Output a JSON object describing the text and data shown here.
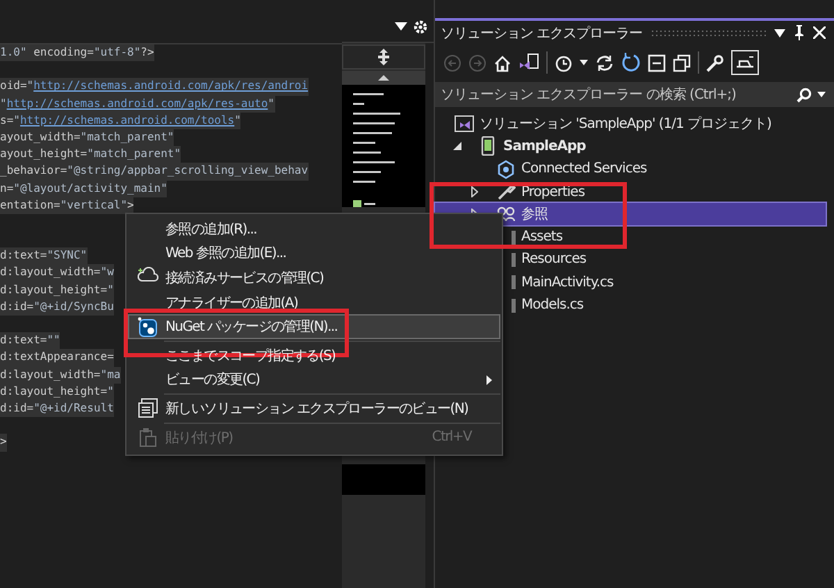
{
  "editor": {
    "lines": [
      {
        "kind": "code",
        "segments": [
          {
            "text": "1.0\"",
            "kind": "value"
          },
          {
            "text": " encoding=",
            "kind": "plain"
          },
          {
            "text": "\"utf-8\"",
            "kind": "value"
          },
          {
            "text": "?>",
            "kind": "plain"
          }
        ]
      },
      {
        "kind": "blank"
      },
      {
        "kind": "code",
        "segments": [
          {
            "text": "oid=",
            "kind": "plain"
          },
          {
            "text": "\"",
            "kind": "value"
          },
          {
            "text": "http://schemas.android.com/apk/res/androi",
            "kind": "link"
          }
        ]
      },
      {
        "kind": "code",
        "segments": [
          {
            "text": "\"",
            "kind": "value"
          },
          {
            "text": "http://schemas.android.com/apk/res-auto",
            "kind": "link"
          },
          {
            "text": "\"",
            "kind": "value"
          }
        ]
      },
      {
        "kind": "code",
        "segments": [
          {
            "text": "s=",
            "kind": "plain"
          },
          {
            "text": "\"",
            "kind": "value"
          },
          {
            "text": "http://schemas.android.com/tools",
            "kind": "link"
          },
          {
            "text": "\"",
            "kind": "value"
          }
        ]
      },
      {
        "kind": "code",
        "segments": [
          {
            "text": "ayout_width=",
            "kind": "plain"
          },
          {
            "text": "\"match_parent\"",
            "kind": "value"
          }
        ]
      },
      {
        "kind": "code",
        "segments": [
          {
            "text": "ayout_height=",
            "kind": "plain"
          },
          {
            "text": "\"match_parent\"",
            "kind": "value"
          }
        ]
      },
      {
        "kind": "code",
        "segments": [
          {
            "text": "_behavior=",
            "kind": "plain"
          },
          {
            "text": "\"@string/appbar_scrolling_view_behav",
            "kind": "value"
          }
        ]
      },
      {
        "kind": "code",
        "segments": [
          {
            "text": "n=",
            "kind": "plain"
          },
          {
            "text": "\"@layout/activity_main\"",
            "kind": "value"
          }
        ]
      },
      {
        "kind": "code",
        "segments": [
          {
            "text": "entation=",
            "kind": "plain"
          },
          {
            "text": "\"vertical\"",
            "kind": "value"
          },
          {
            "text": ">",
            "kind": "plain"
          }
        ]
      },
      {
        "kind": "blank"
      },
      {
        "kind": "blank"
      },
      {
        "kind": "code",
        "segments": [
          {
            "text": "d:text=",
            "kind": "plain"
          },
          {
            "text": "\"SYNC\"",
            "kind": "value"
          }
        ]
      },
      {
        "kind": "code",
        "segments": [
          {
            "text": "d:layout_width=",
            "kind": "plain"
          },
          {
            "text": "\"w",
            "kind": "value"
          }
        ]
      },
      {
        "kind": "code",
        "segments": [
          {
            "text": "d:layout_height=",
            "kind": "plain"
          },
          {
            "text": "\"",
            "kind": "value"
          }
        ]
      },
      {
        "kind": "code",
        "segments": [
          {
            "text": "d:id=",
            "kind": "plain"
          },
          {
            "text": "\"@+id/SyncBu",
            "kind": "value"
          }
        ]
      },
      {
        "kind": "blank"
      },
      {
        "kind": "code",
        "segments": [
          {
            "text": "d:text=",
            "kind": "plain"
          },
          {
            "text": "\"\"",
            "kind": "value"
          }
        ]
      },
      {
        "kind": "code",
        "segments": [
          {
            "text": "d:textAppearance=",
            "kind": "plain"
          }
        ]
      },
      {
        "kind": "code",
        "segments": [
          {
            "text": "d:layout_width=",
            "kind": "plain"
          },
          {
            "text": "\"ma",
            "kind": "value"
          }
        ]
      },
      {
        "kind": "code",
        "segments": [
          {
            "text": "d:layout_height=",
            "kind": "plain"
          },
          {
            "text": "\"",
            "kind": "value"
          }
        ]
      },
      {
        "kind": "code",
        "segments": [
          {
            "text": "d:id=",
            "kind": "plain"
          },
          {
            "text": "\"@+id/Result",
            "kind": "value"
          }
        ]
      },
      {
        "kind": "blank"
      },
      {
        "kind": "code",
        "segments": [
          {
            "text": ">",
            "kind": "plain"
          }
        ]
      }
    ]
  },
  "solution_explorer": {
    "title": "ソリューション エクスプローラー",
    "search": {
      "placeholder": "ソリューション エクスプローラー の検索 (Ctrl+;)"
    },
    "tree": [
      {
        "label": "ソリューション 'SampleApp' (1/1 プロジェクト)",
        "kind": "solution",
        "selected": false,
        "annotated": false,
        "children": [
          {
            "label": "SampleApp",
            "kind": "project",
            "expanded": true,
            "selected": false,
            "annotated": false,
            "children": [
              {
                "label": "Connected Services",
                "kind": "services",
                "selected": false,
                "annotated": false
              },
              {
                "label": "Properties",
                "kind": "properties",
                "expanded": false,
                "selected": false,
                "annotated": false
              },
              {
                "label": "参照",
                "kind": "references",
                "expanded": false,
                "selected": true,
                "annotated": true
              },
              {
                "label": "Assets",
                "kind": "folder",
                "selected": false,
                "annotated": false
              },
              {
                "label": "Resources",
                "kind": "folder",
                "selected": false,
                "annotated": false
              },
              {
                "label": "MainActivity.cs",
                "kind": "file",
                "selected": false,
                "annotated": false
              },
              {
                "label": "Models.cs",
                "kind": "file",
                "selected": false,
                "annotated": false
              }
            ]
          }
        ]
      }
    ]
  },
  "context_menu": [
    {
      "kind": "plain",
      "label": "参照の追加(R)...",
      "highlighted": false,
      "disabled": false,
      "annotated": false
    },
    {
      "kind": "plain",
      "label": "Web 参照の追加(E)...",
      "highlighted": false,
      "disabled": false,
      "annotated": false
    },
    {
      "kind": "services",
      "label": "接続済みサービスの管理(C)",
      "highlighted": false,
      "disabled": false,
      "annotated": false
    },
    {
      "kind": "plain",
      "label": "アナライザーの追加(A)",
      "highlighted": false,
      "disabled": false,
      "annotated": false
    },
    {
      "kind": "nuget",
      "label": "NuGet パッケージの管理(N)...",
      "highlighted": true,
      "disabled": false,
      "annotated": true
    },
    {
      "kind": "separator"
    },
    {
      "kind": "plain",
      "label": "ここまでスコープ指定する(S)",
      "highlighted": false,
      "disabled": false,
      "annotated": false
    },
    {
      "kind": "submenu",
      "label": "ビューの変更(C)",
      "highlighted": false,
      "disabled": false,
      "annotated": false
    },
    {
      "kind": "separator"
    },
    {
      "kind": "newview",
      "label": "新しいソリューション エクスプローラーのビュー(N)",
      "highlighted": false,
      "disabled": false,
      "annotated": false
    },
    {
      "kind": "separator"
    },
    {
      "kind": "paste",
      "label": "貼り付け(P)",
      "shortcut": "Ctrl+V",
      "highlighted": false,
      "disabled": true,
      "annotated": false
    }
  ]
}
